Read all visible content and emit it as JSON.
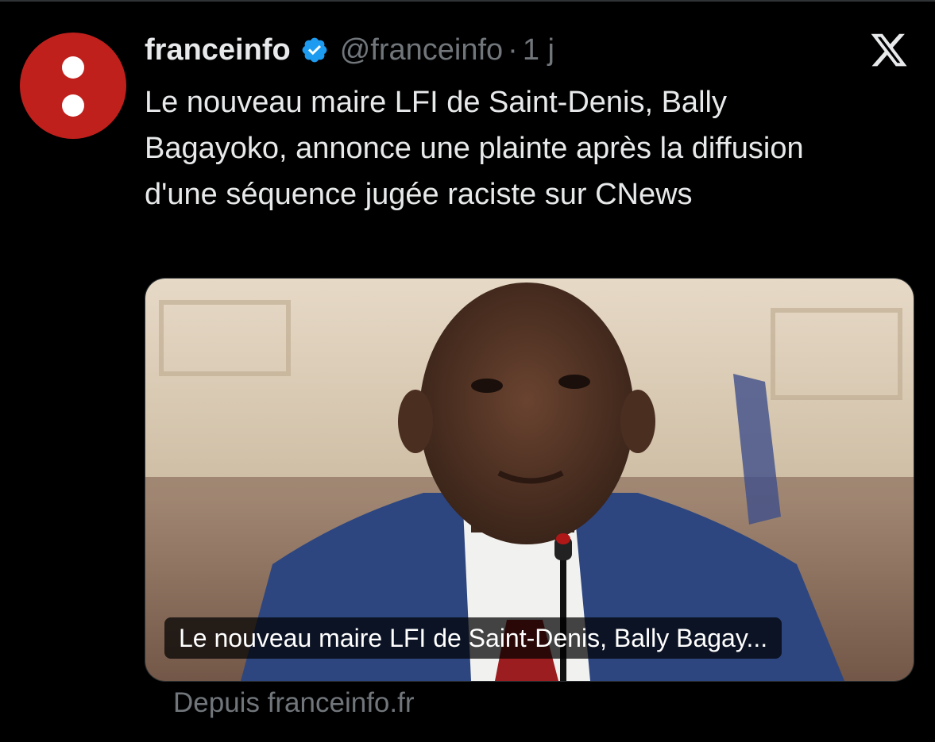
{
  "tweet": {
    "author_name": "franceinfo",
    "handle": "@franceinfo",
    "separator": "·",
    "time": "1 j",
    "text": "Le nouveau maire LFI de Saint-Denis, Bally Bagayoko, annonce une plainte après la diffusion d'une séquence jugée raciste sur CNews"
  },
  "card": {
    "caption": "Le nouveau maire LFI de Saint-Denis, Bally Bagay...",
    "source": "Depuis franceinfo.fr"
  },
  "colors": {
    "background": "#000000",
    "text": "#e7e9ea",
    "muted": "#71767b",
    "verified": "#1d9bf0",
    "avatar": "#c0201c"
  },
  "icons": {
    "verified": "verified-badge-icon",
    "platform": "x-logo-icon"
  }
}
